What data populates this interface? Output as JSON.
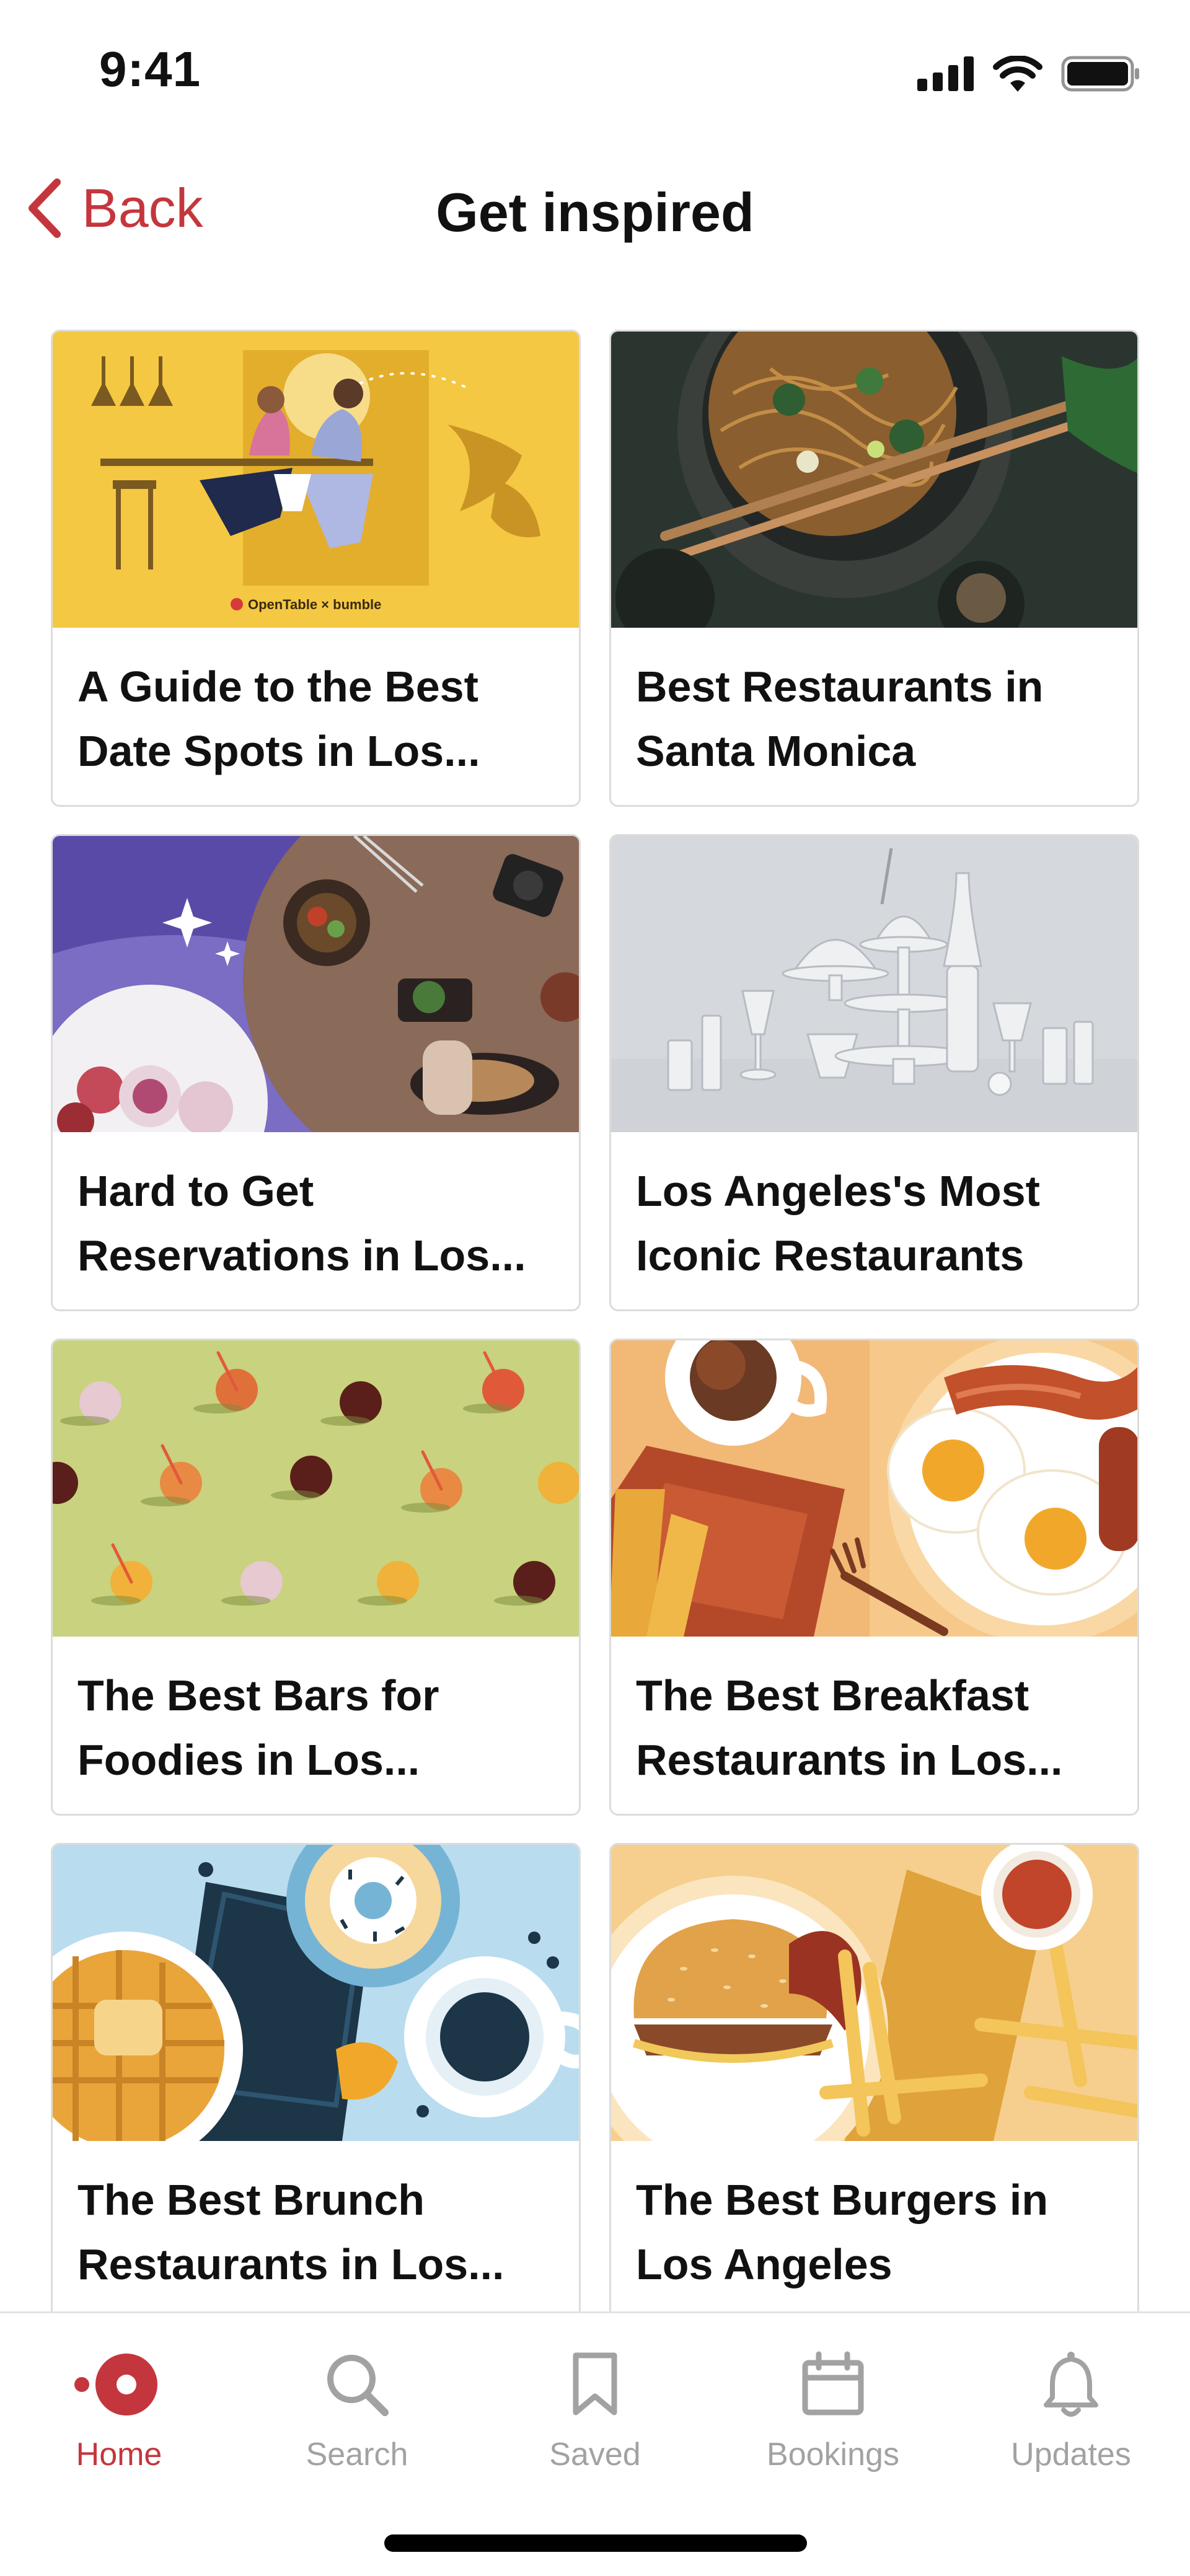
{
  "status_bar": {
    "time": "9:41"
  },
  "nav": {
    "back_label": "Back",
    "title": "Get inspired"
  },
  "cards": [
    {
      "title": "A Guide to the Best Date Spots in Los...",
      "image": "date-spots-illustration",
      "image_caption": "OpenTable × bumble"
    },
    {
      "title": "Best Restaurants in Santa Monica",
      "image": "noodles-chopsticks-photo"
    },
    {
      "title": "Hard to Get Reservations in Los...",
      "image": "dinner-table-photo"
    },
    {
      "title": "Los Angeles's Most Iconic Restaurants",
      "image": "glassware-photo"
    },
    {
      "title": "The Best Bars for Foodies in Los...",
      "image": "cocktails-pattern-photo"
    },
    {
      "title": "The Best Breakfast Restaurants in Los...",
      "image": "breakfast-illustration"
    },
    {
      "title": "The Best Brunch Restaurants in Los...",
      "image": "brunch-illustration"
    },
    {
      "title": "The Best Burgers in Los Angeles",
      "image": "burger-illustration"
    }
  ],
  "tabs": [
    {
      "label": "Home",
      "icon": "home-dot-icon",
      "active": true
    },
    {
      "label": "Search",
      "icon": "search-icon",
      "active": false
    },
    {
      "label": "Saved",
      "icon": "bookmark-icon",
      "active": false
    },
    {
      "label": "Bookings",
      "icon": "calendar-icon",
      "active": false
    },
    {
      "label": "Updates",
      "icon": "bell-icon",
      "active": false
    }
  ],
  "colors": {
    "accent": "#c4363d",
    "inactive": "#a2a2a2",
    "border": "#dcdcdc"
  }
}
